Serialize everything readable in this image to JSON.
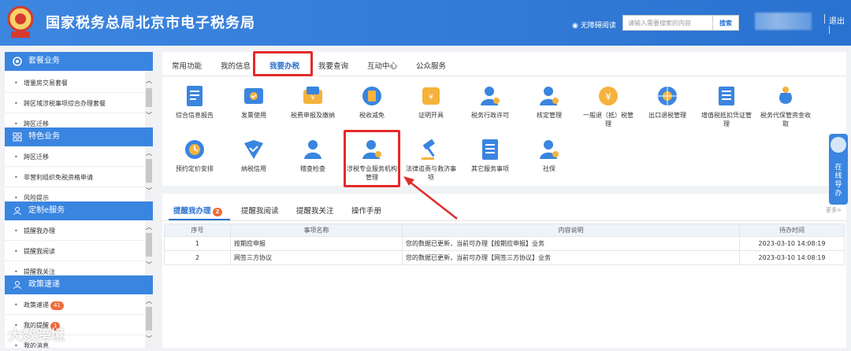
{
  "header": {
    "title": "国家税务总局北京市电子税务局",
    "accessibility": "无障碍阅读",
    "search_placeholder": "请输入需要搜索的内容",
    "search_button": "搜索",
    "logout": "退出",
    "brand_color": "#2a72cf"
  },
  "sidebar": {
    "sections": [
      {
        "title": "套餐业务",
        "icon": "package-icon",
        "items": [
          "增量房交易套餐",
          "跨区域涉税事项综合办理套餐",
          "跨区迁移"
        ]
      },
      {
        "title": "特色业务",
        "icon": "grid-icon",
        "items": [
          "跨区迁移",
          "非营利组织免税资格申请",
          "风险提示"
        ]
      },
      {
        "title": "定制e服务",
        "icon": "user-icon",
        "items": [
          "提醒我办理",
          "提醒我阅读",
          "提醒我关注"
        ]
      },
      {
        "title": "政策速递",
        "icon": "user-icon",
        "items": [
          "政策速递",
          "我的提醒",
          "我的消息"
        ]
      }
    ],
    "badges": {
      "policy": "41",
      "reminder": "1"
    }
  },
  "main": {
    "tabs": [
      "常用功能",
      "我的信息",
      "我要办税",
      "我要查询",
      "互动中心",
      "公众服务"
    ],
    "active_tab": "我要办税",
    "tiles": [
      {
        "label": "综合信息报告",
        "icon": "report-icon"
      },
      {
        "label": "发票使用",
        "icon": "invoice-icon"
      },
      {
        "label": "税费申报及缴纳",
        "icon": "tax-payment-icon"
      },
      {
        "label": "税收减免",
        "icon": "coins-icon"
      },
      {
        "label": "证明开具",
        "icon": "certificate-icon"
      },
      {
        "label": "税务行政许可",
        "icon": "license-user-icon"
      },
      {
        "label": "核定管理",
        "icon": "verify-user-icon"
      },
      {
        "label": "一般退（抵）税管理",
        "icon": "refund-icon"
      },
      {
        "label": "出口退税管理",
        "icon": "globe-icon"
      },
      {
        "label": "增值税抵扣凭证管理",
        "icon": "voucher-icon"
      },
      {
        "label": "税务代保管资金收取",
        "icon": "moneybag-icon"
      },
      {
        "label": "预约定价安排",
        "icon": "clock-icon"
      },
      {
        "label": "纳税信用",
        "icon": "shield-check-icon"
      },
      {
        "label": "稽查检查",
        "icon": "inspector-icon"
      },
      {
        "label": "涉税专业服务机构管理",
        "icon": "agency-user-icon"
      },
      {
        "label": "法律追责与救济事项",
        "icon": "gavel-icon"
      },
      {
        "label": "其它服务事项",
        "icon": "document-list-icon"
      },
      {
        "label": "社保",
        "icon": "social-security-icon"
      }
    ]
  },
  "reminders": {
    "tabs": [
      "提醒我办理",
      "提醒我阅读",
      "提醒我关注",
      "操作手册"
    ],
    "badge": "2",
    "more": "更多>",
    "columns": [
      "序号",
      "事项名称",
      "内容说明",
      "待办时间"
    ],
    "rows": [
      [
        "1",
        "按期应申报",
        "您的数据已更新，当前可办理【按期应申报】业务",
        "2023-03-10 14:08:19"
      ],
      [
        "2",
        "网签三方协议",
        "您的数据已更新，当前可办理【网签三方协议】业务",
        "2023-03-10 14:08:19"
      ]
    ]
  },
  "float_help": "在线导办",
  "watermark": "大数跨境",
  "colors": {
    "highlight": "#e42a2a",
    "accent": "#3a85e0",
    "badge": "#ef6b3a"
  }
}
